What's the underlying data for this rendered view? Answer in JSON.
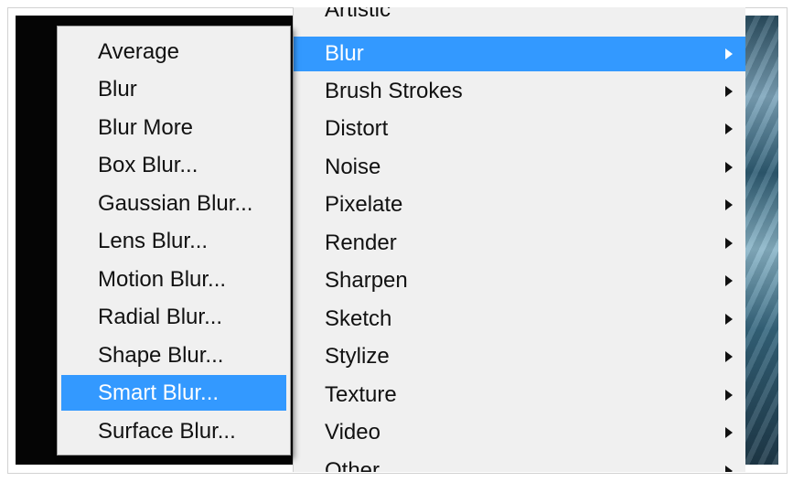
{
  "main_menu": {
    "cut_off_top_label": "Artistic",
    "cut_off_bottom_label": "Other",
    "items": [
      {
        "label": "Blur",
        "active": true
      },
      {
        "label": "Brush Strokes"
      },
      {
        "label": "Distort"
      },
      {
        "label": "Noise"
      },
      {
        "label": "Pixelate"
      },
      {
        "label": "Render"
      },
      {
        "label": "Sharpen"
      },
      {
        "label": "Sketch"
      },
      {
        "label": "Stylize"
      },
      {
        "label": "Texture"
      },
      {
        "label": "Video"
      }
    ]
  },
  "blur_submenu": {
    "items": [
      {
        "label": "Average"
      },
      {
        "label": "Blur"
      },
      {
        "label": "Blur More"
      },
      {
        "label": "Box Blur..."
      },
      {
        "label": "Gaussian Blur..."
      },
      {
        "label": "Lens Blur..."
      },
      {
        "label": "Motion Blur..."
      },
      {
        "label": "Radial Blur..."
      },
      {
        "label": "Shape Blur..."
      },
      {
        "label": "Smart Blur...",
        "active": true
      },
      {
        "label": "Surface Blur..."
      }
    ]
  },
  "colors": {
    "highlight": "#3399ff",
    "menu_background": "#f0f0f0"
  },
  "icons": {
    "submenu_arrow": "chevron-right-icon"
  }
}
